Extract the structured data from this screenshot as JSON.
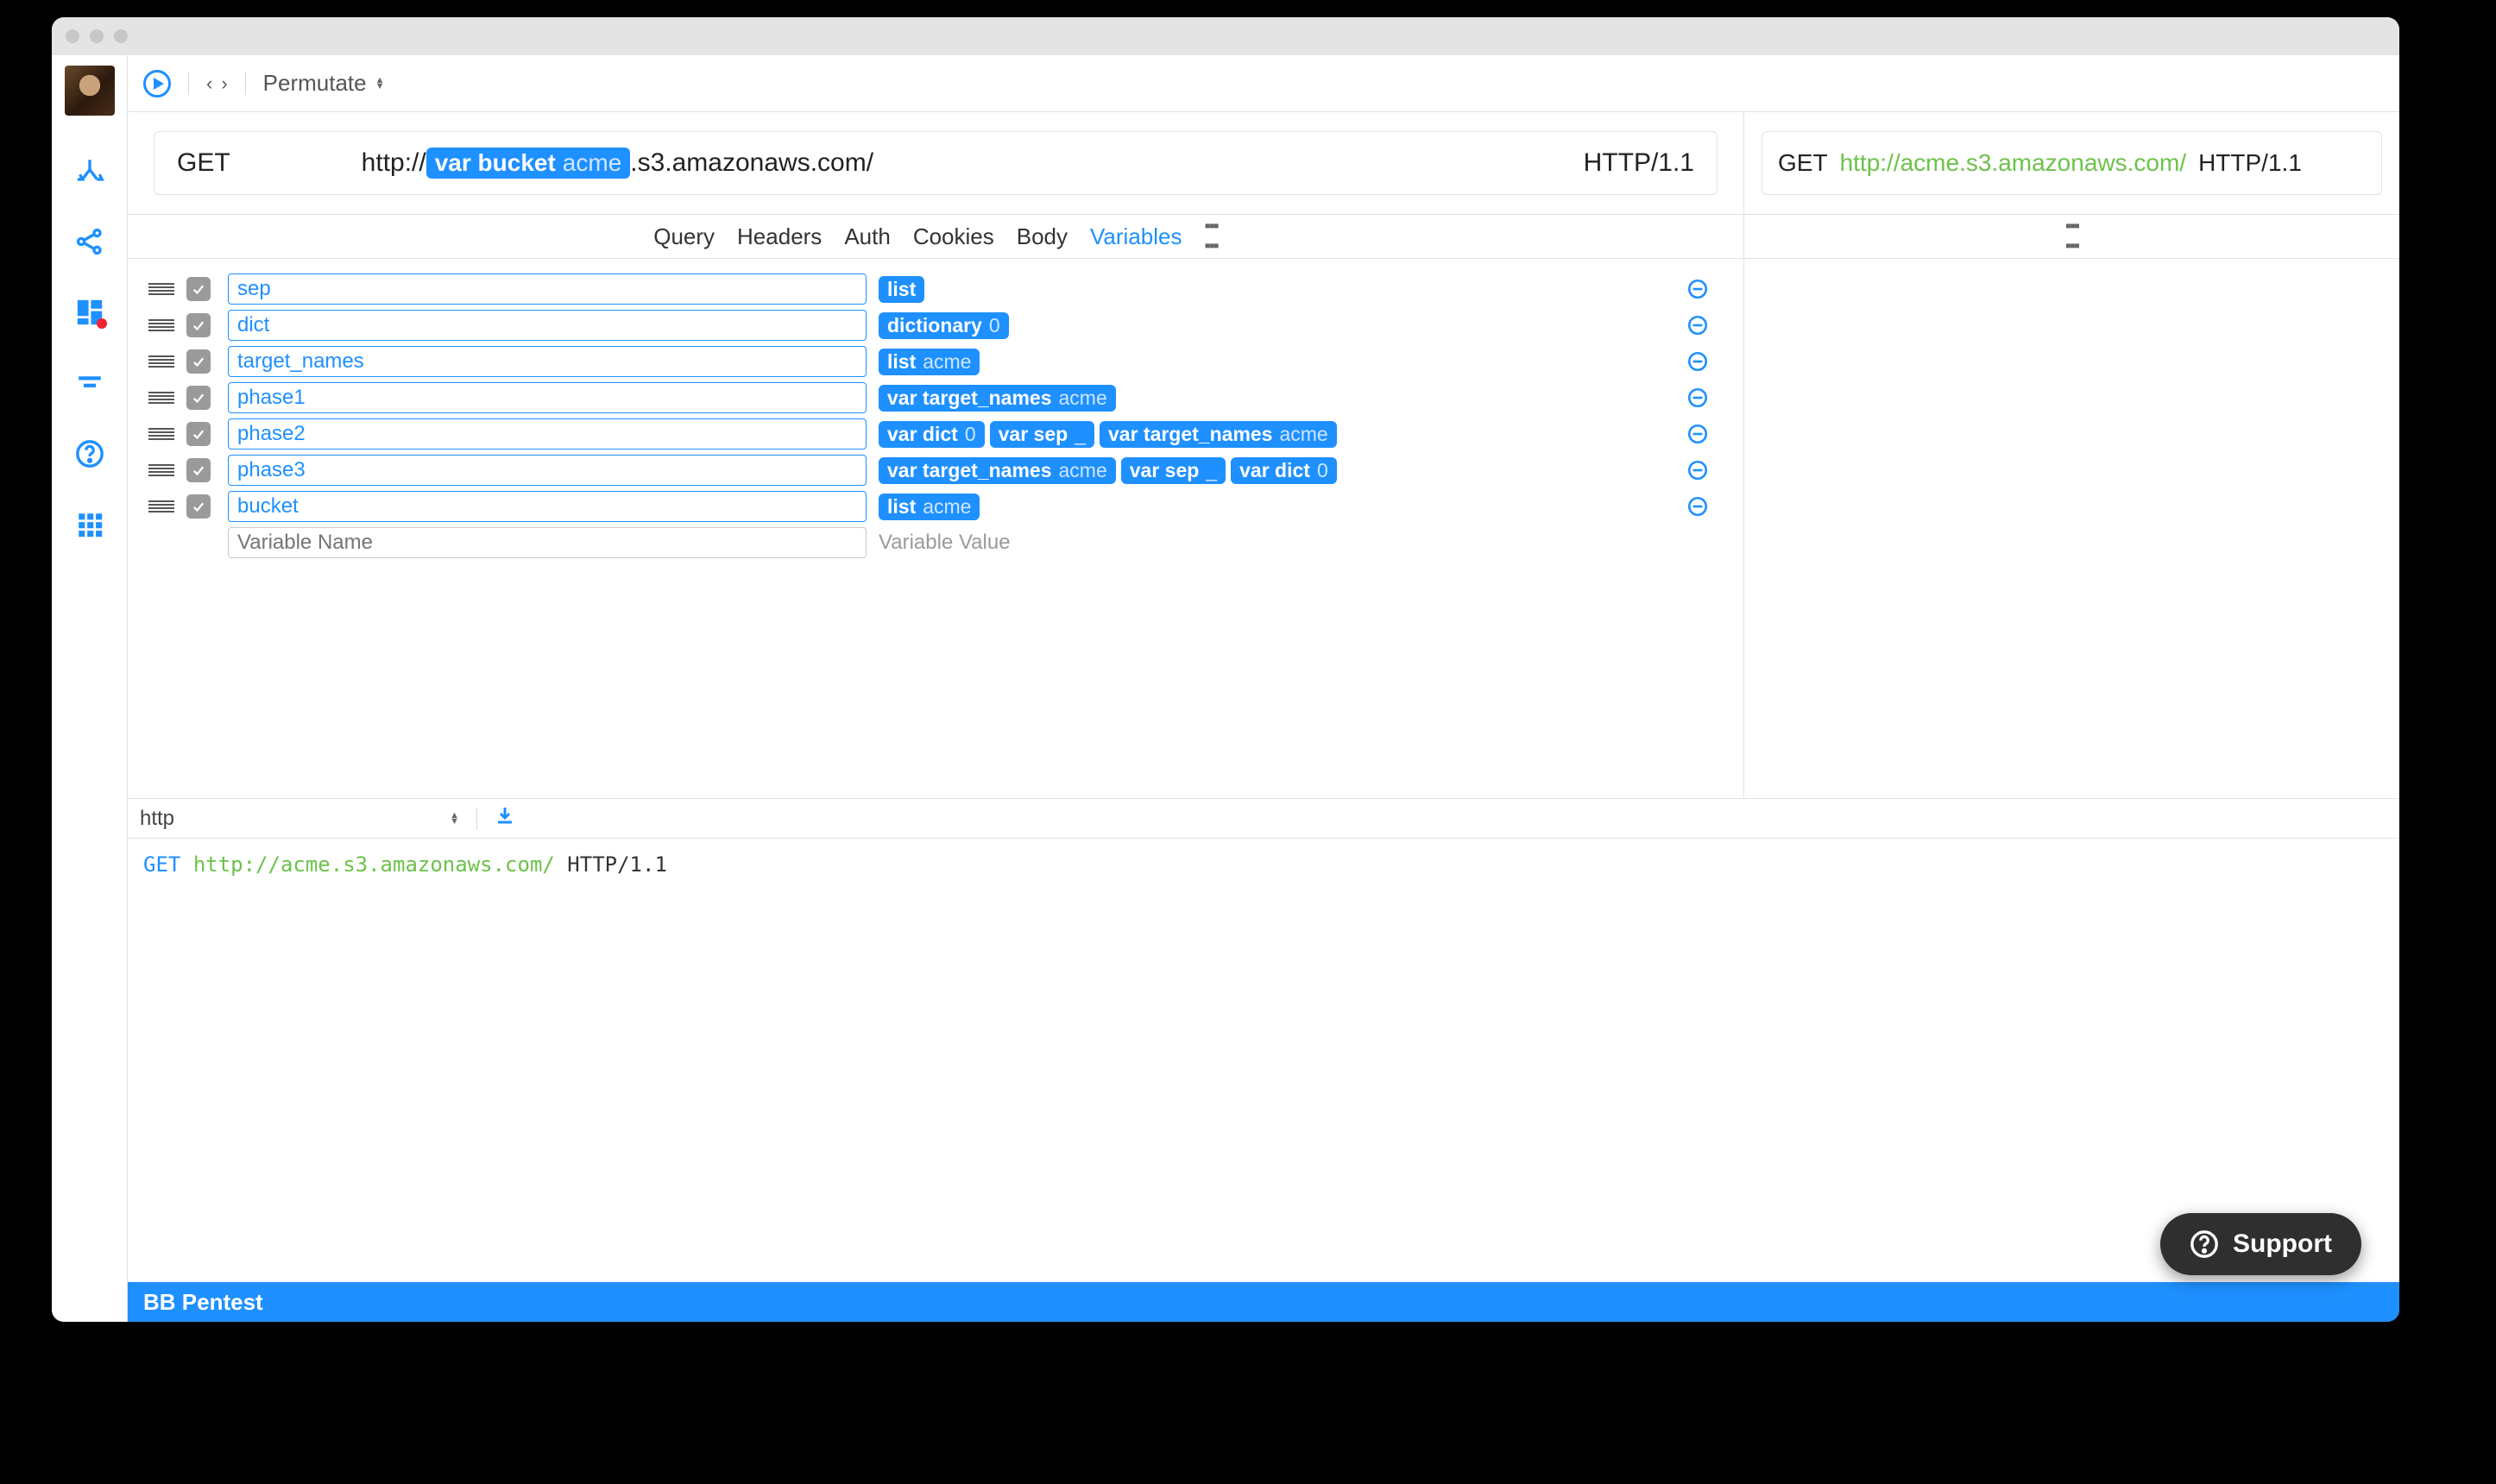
{
  "toolbar": {
    "mode_label": "Permutate"
  },
  "request": {
    "method": "GET",
    "url_prefix": "http://",
    "url_suffix": ".s3.amazonaws.com/",
    "chip": {
      "kind": "var",
      "name": "bucket",
      "sample": "acme"
    },
    "http_version": "HTTP/1.1"
  },
  "preview": {
    "method": "GET",
    "url": "http://acme.s3.amazonaws.com/",
    "http_version": "HTTP/1.1"
  },
  "tabs": [
    "Query",
    "Headers",
    "Auth",
    "Cookies",
    "Body",
    "Variables"
  ],
  "active_tab": "Variables",
  "variables": [
    {
      "name": "sep",
      "value": [
        {
          "kind": "list"
        }
      ]
    },
    {
      "name": "dict",
      "value": [
        {
          "kind": "dictionary",
          "sample": "0"
        }
      ]
    },
    {
      "name": "target_names",
      "value": [
        {
          "kind": "list",
          "sample": "acme"
        }
      ]
    },
    {
      "name": "phase1",
      "value": [
        {
          "kind": "var",
          "name": "target_names",
          "sample": "acme"
        }
      ]
    },
    {
      "name": "phase2",
      "value": [
        {
          "kind": "var",
          "name": "dict",
          "sample": "0"
        },
        {
          "kind": "var",
          "name": "sep",
          "sample": "_"
        },
        {
          "kind": "var",
          "name": "target_names",
          "sample": "acme"
        }
      ]
    },
    {
      "name": "phase3",
      "value": [
        {
          "kind": "var",
          "name": "target_names",
          "sample": "acme"
        },
        {
          "kind": "var",
          "name": "sep",
          "sample": "_"
        },
        {
          "kind": "var",
          "name": "dict",
          "sample": "0"
        }
      ]
    },
    {
      "name": "bucket",
      "value": [
        {
          "kind": "list",
          "sample": "acme"
        }
      ]
    }
  ],
  "var_name_placeholder": "Variable Name",
  "var_value_placeholder": "Variable Value",
  "raw": {
    "format": "http",
    "method": "GET",
    "url": "http://acme.s3.amazonaws.com/",
    "http_version": "HTTP/1.1"
  },
  "footer": {
    "project": "BB Pentest"
  },
  "support_label": "Support"
}
